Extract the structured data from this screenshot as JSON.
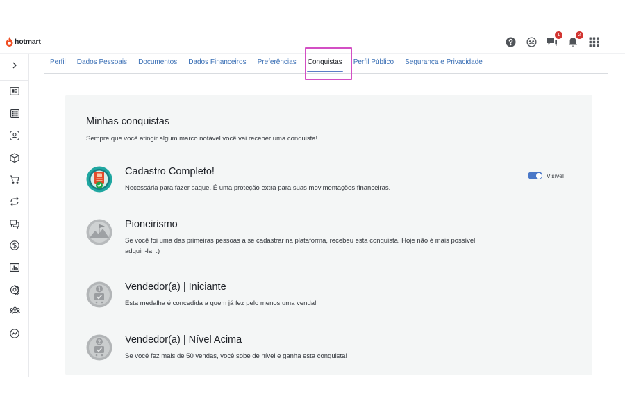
{
  "brand": {
    "name": "hotmart",
    "color": "#f04e23"
  },
  "header": {
    "icons": [
      {
        "name": "help-icon",
        "badge": null
      },
      {
        "name": "community-icon",
        "badge": null
      },
      {
        "name": "chat-icon",
        "badge": "1"
      },
      {
        "name": "bell-icon",
        "badge": "2"
      },
      {
        "name": "apps-grid-icon",
        "badge": null
      }
    ]
  },
  "sidebar": {
    "toggle_icon": "chevron-right-icon",
    "items": [
      "dashboard-icon",
      "products-grid-icon",
      "affiliate-icon",
      "box-icon",
      "cart-icon",
      "sync-icon",
      "chat-bubbles-icon",
      "dollar-icon",
      "bar-chart-icon",
      "gear-icon",
      "users-icon",
      "analytics-icon"
    ]
  },
  "tabs": [
    {
      "label": "Perfil",
      "active": false
    },
    {
      "label": "Dados Pessoais",
      "active": false
    },
    {
      "label": "Documentos",
      "active": false
    },
    {
      "label": "Dados Financeiros",
      "active": false
    },
    {
      "label": "Preferências",
      "active": false
    },
    {
      "label": "Conquistas",
      "active": true
    },
    {
      "label": "Perfil Público",
      "active": false
    },
    {
      "label": "Segurança e Privacidade",
      "active": false
    }
  ],
  "highlight_color": "#d34fc4",
  "achievements": {
    "title": "Minhas conquistas",
    "subtitle": "Sempre que você atingir algum marco notável você vai receber uma conquista!",
    "items": [
      {
        "title": "Cadastro Completo!",
        "description": "Necessária para fazer saque. É uma proteção extra para suas movimentações financeiras.",
        "medal": "document-check-medal-icon",
        "unlocked": true,
        "visibility_label": "Visível",
        "visible": true
      },
      {
        "title": "Pioneirismo",
        "description": "Se você foi uma das primeiras pessoas a se cadastrar na plataforma, recebeu esta conquista. Hoje não é mais possível adquiri-la. :)",
        "medal": "flag-medal-icon",
        "unlocked": false
      },
      {
        "title": "Vendedor(a) | Iniciante",
        "description": "Esta medalha é concedida a quem já fez pelo menos uma venda!",
        "medal": "level-1-medal-icon",
        "unlocked": false
      },
      {
        "title": "Vendedor(a) | Nível Acima",
        "description": "Se você fez mais de 50 vendas, você sobe de nível e ganha esta conquista!",
        "medal": "level-2-medal-icon",
        "unlocked": false
      }
    ]
  }
}
